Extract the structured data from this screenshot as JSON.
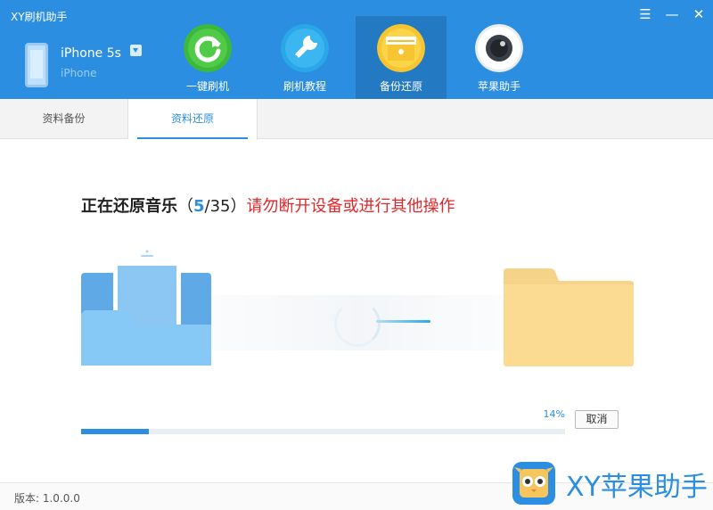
{
  "app": {
    "title": "XY刷机助手"
  },
  "window_controls": {
    "menu": "☰",
    "minimize": "—",
    "close": "✕"
  },
  "device": {
    "name": "iPhone 5s",
    "type": "iPhone"
  },
  "nav": [
    {
      "label": "一键刷机",
      "icon": "refresh-icon",
      "color": "#3cb83c",
      "active": false
    },
    {
      "label": "刷机教程",
      "icon": "wrench-icon",
      "color": "#2aa7e8",
      "active": false
    },
    {
      "label": "备份还原",
      "icon": "box-icon",
      "color": "#f6c531",
      "active": true
    },
    {
      "label": "苹果助手",
      "icon": "camera-icon",
      "color": "#ffffff",
      "active": false
    }
  ],
  "tabs": [
    {
      "label": "资料备份",
      "active": false
    },
    {
      "label": "资料还原",
      "active": true
    }
  ],
  "status": {
    "title": "正在还原音乐",
    "open_paren": "（",
    "current": "5",
    "separator": "/",
    "total": "35",
    "close_paren": "）",
    "warning": "请勿断开设备或进行其他操作"
  },
  "progress": {
    "percent_label": "14%",
    "value": 0.14
  },
  "cancel": {
    "label": "取消"
  },
  "footer": {
    "version": "版本: 1.0.0.0",
    "brand": "XY苹果助手"
  },
  "colors": {
    "accent": "#2b8ee0",
    "warning": "#e0282c",
    "header_bg": "#2b8ee0"
  }
}
